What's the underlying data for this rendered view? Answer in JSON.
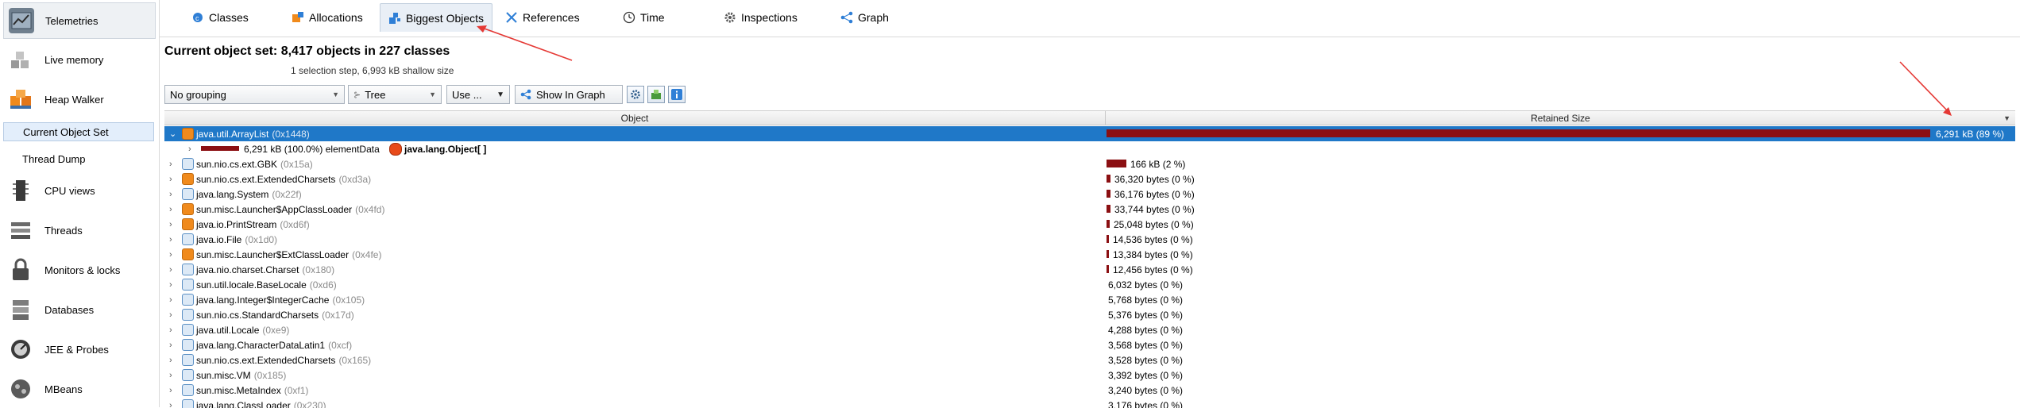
{
  "sidebar": {
    "items": [
      {
        "label": "Telemetries",
        "icon": "telemetries-icon"
      },
      {
        "label": "Live memory",
        "icon": "live-memory-icon"
      },
      {
        "label": "Heap Walker",
        "icon": "heap-walker-icon"
      },
      {
        "label": "Current Object Set"
      },
      {
        "label": "Thread Dump"
      },
      {
        "label": "CPU views",
        "icon": "cpu-views-icon"
      },
      {
        "label": "Threads",
        "icon": "threads-icon"
      },
      {
        "label": "Monitors & locks",
        "icon": "lock-icon"
      },
      {
        "label": "Databases",
        "icon": "database-icon"
      },
      {
        "label": "JEE & Probes",
        "icon": "probes-icon"
      },
      {
        "label": "MBeans",
        "icon": "mbeans-icon"
      }
    ]
  },
  "tabs": [
    {
      "label": "Classes",
      "icon": "classes-icon"
    },
    {
      "label": "Allocations",
      "icon": "allocations-icon"
    },
    {
      "label": "Biggest Objects",
      "icon": "biggest-objects-icon",
      "active": true
    },
    {
      "label": "References",
      "icon": "references-icon"
    },
    {
      "label": "Time",
      "icon": "clock-icon"
    },
    {
      "label": "Inspections",
      "icon": "gear-icon"
    },
    {
      "label": "Graph",
      "icon": "graph-icon"
    }
  ],
  "header": {
    "title": "Current object set:  8,417 objects in 227 classes",
    "subtitle": "1 selection step, 6,993 kB shallow size"
  },
  "toolbar": {
    "grouping": "No grouping",
    "view_mode": "Tree",
    "use_label": "Use ...",
    "show_in_graph": "Show In Graph"
  },
  "table": {
    "columns": [
      "Object",
      "Retained Size"
    ],
    "selected_row": {
      "name": "java.util.ArrayList",
      "addr": "(0x1448)",
      "size": "6,291 kB (89 %)",
      "fraction": 0.89,
      "child": {
        "text": "6,291 kB (100.0%) elementData",
        "object": "java.lang.Object[ ]"
      }
    },
    "rows": [
      {
        "name": "sun.nio.cs.ext.GBK",
        "addr": "(0x15a)",
        "size": "166 kB (2 %)",
        "fraction": 0.024,
        "icon": "blue"
      },
      {
        "name": "sun.nio.cs.ext.ExtendedCharsets",
        "addr": "(0xd3a)",
        "size": "36,320 bytes (0 %)",
        "fraction": 0.005,
        "icon": "orange"
      },
      {
        "name": "java.lang.System",
        "addr": "(0x22f)",
        "size": "36,176 bytes (0 %)",
        "fraction": 0.005,
        "icon": "blue"
      },
      {
        "name": "sun.misc.Launcher$AppClassLoader",
        "addr": "(0x4fd)",
        "size": "33,744 bytes (0 %)",
        "fraction": 0.005,
        "icon": "orange"
      },
      {
        "name": "java.io.PrintStream",
        "addr": "(0xd6f)",
        "size": "25,048 bytes (0 %)",
        "fraction": 0.0035,
        "icon": "orange"
      },
      {
        "name": "java.io.File",
        "addr": "(0x1d0)",
        "size": "14,536 bytes (0 %)",
        "fraction": 0.002,
        "icon": "blue"
      },
      {
        "name": "sun.misc.Launcher$ExtClassLoader",
        "addr": "(0x4fe)",
        "size": "13,384 bytes (0 %)",
        "fraction": 0.0019,
        "icon": "orange"
      },
      {
        "name": "java.nio.charset.Charset",
        "addr": "(0x180)",
        "size": "12,456 bytes (0 %)",
        "fraction": 0.0018,
        "icon": "blue"
      },
      {
        "name": "sun.util.locale.BaseLocale",
        "addr": "(0xd6)",
        "size": "6,032 bytes (0 %)",
        "fraction": 0,
        "icon": "blue"
      },
      {
        "name": "java.lang.Integer$IntegerCache",
        "addr": "(0x105)",
        "size": "5,768 bytes (0 %)",
        "fraction": 0,
        "icon": "blue"
      },
      {
        "name": "sun.nio.cs.StandardCharsets",
        "addr": "(0x17d)",
        "size": "5,376 bytes (0 %)",
        "fraction": 0,
        "icon": "blue"
      },
      {
        "name": "java.util.Locale",
        "addr": "(0xe9)",
        "size": "4,288 bytes (0 %)",
        "fraction": 0,
        "icon": "blue"
      },
      {
        "name": "java.lang.CharacterDataLatin1",
        "addr": "(0xcf)",
        "size": "3,568 bytes (0 %)",
        "fraction": 0,
        "icon": "blue"
      },
      {
        "name": "sun.nio.cs.ext.ExtendedCharsets",
        "addr": "(0x165)",
        "size": "3,528 bytes (0 %)",
        "fraction": 0,
        "icon": "blue"
      },
      {
        "name": "sun.misc.VM",
        "addr": "(0x185)",
        "size": "3,392 bytes (0 %)",
        "fraction": 0,
        "icon": "blue"
      },
      {
        "name": "sun.misc.MetaIndex",
        "addr": "(0xf1)",
        "size": "3,240 bytes (0 %)",
        "fraction": 0,
        "icon": "blue"
      },
      {
        "name": "java.lang.ClassLoader",
        "addr": "(0x230)",
        "size": "3,176 bytes (0 %)",
        "fraction": 0,
        "icon": "blue"
      }
    ]
  },
  "colors": {
    "selection": "#1f78c8",
    "bar": "#8b0f12",
    "annotation_arrow": "#e53935"
  }
}
